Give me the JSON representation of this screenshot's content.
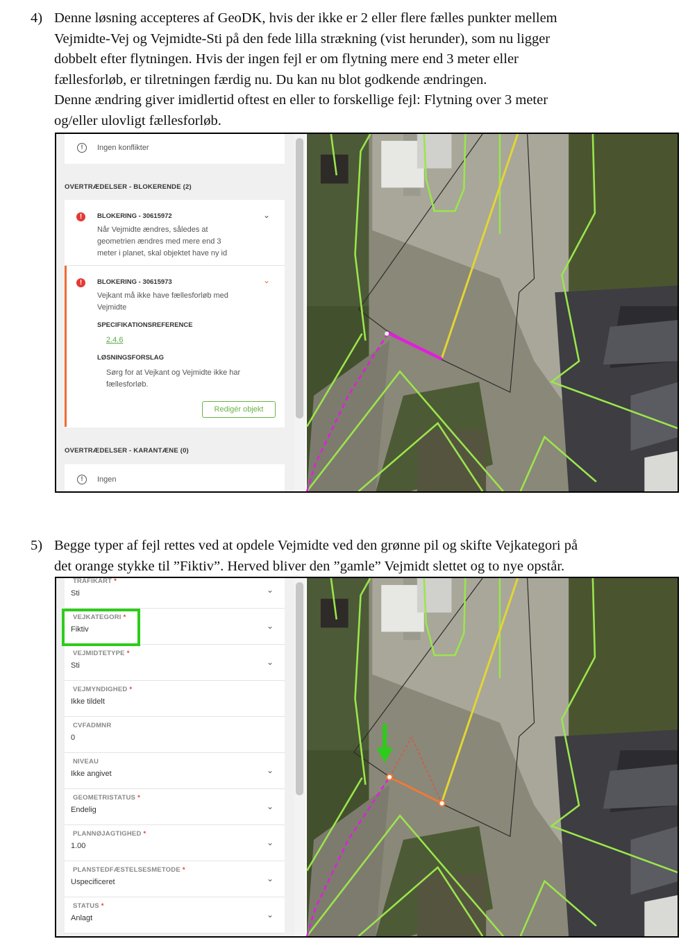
{
  "step4": {
    "number": "4)",
    "lines": [
      "Denne løsning accepteres af GeoDK, hvis der ikke er 2 eller flere fælles punkter mellem",
      "Vejmidte-Vej og Vejmidte-Sti på den fede lilla strækning (vist herunder), som nu ligger",
      "dobbelt efter flytningen. Hvis der ingen fejl er om flytning mere end 3 meter eller",
      "fællesforløb, er tilretningen færdig nu. Du kan nu blot godkende ændringen.",
      "Denne ændring giver imidlertid oftest en eller to forskellige fejl: Flytning over 3 meter",
      "og/eller ulovligt fællesforløb."
    ]
  },
  "step5": {
    "number": "5)",
    "lines": [
      "Begge typer af fejl rettes ved at opdele Vejmidte ved den grønne pil og skifte Vejkategori på",
      "det orange stykke til ”Fiktiv”. Herved bliver den ”gamle” Vejmidt slettet og to nye opstår."
    ]
  },
  "panel1": {
    "no_conflicts": "Ingen konflikter",
    "blocking_header": "OVERTRÆDELSER - BLOKERENDE (2)",
    "error1": {
      "title": "BLOKERING - 30615972",
      "lines": [
        "Når Vejmidte ændres, således at",
        "geometrien ændres med mere end 3",
        "meter i planet, skal objektet have ny id"
      ]
    },
    "error2": {
      "title": "BLOKERING - 30615973",
      "lines": [
        "Vejkant må ikke have fællesforløb med",
        "Vejmidte"
      ],
      "spec_label": "SPECIFIKATIONSREFERENCE",
      "spec_link": "2.4.6",
      "solution_label": "LØSNINGSFORSLAG",
      "solution_lines": [
        "Sørg for at Vejkant og Vejmidte ikke har",
        "fællesforløb."
      ],
      "button": "Redigér objekt"
    },
    "quarantine_header": "OVERTRÆDELSER - KARANTÆNE (0)",
    "none": "Ingen"
  },
  "panel2": {
    "fields": [
      {
        "label": "TRAFIKART",
        "required": "*",
        "value": "Sti"
      },
      {
        "label": "VEJKATEGORI",
        "required": "*",
        "value": "Fiktiv"
      },
      {
        "label": "VEJMIDTETYPE",
        "required": "*",
        "value": "Sti"
      },
      {
        "label": "VEJMYNDIGHED",
        "required": "*",
        "value": "Ikke tildelt"
      },
      {
        "label": "CVFADMNR",
        "required": "",
        "value": "0"
      },
      {
        "label": "NIVEAU",
        "required": "",
        "value": "Ikke angivet"
      },
      {
        "label": "GEOMETRISTATUS",
        "required": "*",
        "value": "Endelig"
      },
      {
        "label": "PLANNØJAGTIGHED",
        "required": "*",
        "value": "1.00"
      },
      {
        "label": "PLANSTEDFÆSTELSESMETODE",
        "required": "*",
        "value": "Uspecificeret"
      },
      {
        "label": "STATUS",
        "required": "*",
        "value": "Anlagt"
      }
    ]
  },
  "colors": {
    "parcel_line": "#9be64b",
    "road_center_yellow": "#e3d534",
    "path_magenta": "#e01fdc",
    "segment_orange": "#f07a38",
    "highlight_green": "#2ecc1a",
    "error_red": "#e53935"
  }
}
